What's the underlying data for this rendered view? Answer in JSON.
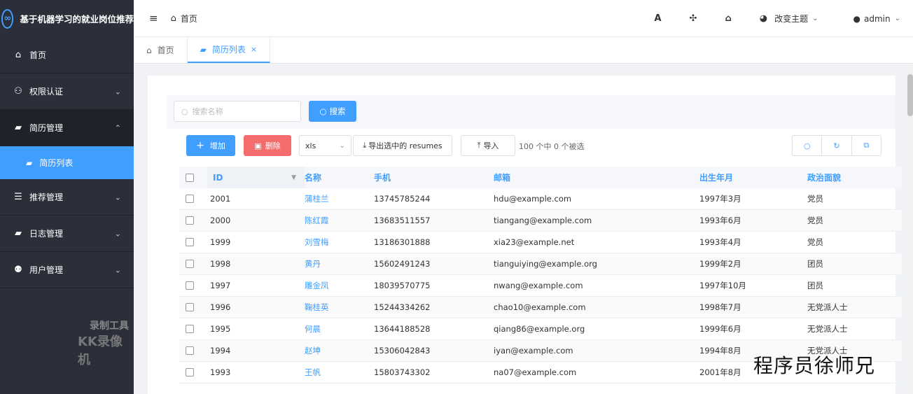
{
  "brand": {
    "logo": "∞",
    "title": "基于机器学习的就业岗位推荐"
  },
  "sidebar": {
    "items": [
      {
        "label": "首页",
        "icon": "home-icon",
        "glyph": "⌂"
      },
      {
        "label": "权限认证",
        "icon": "user-cog-icon",
        "glyph": "⚇"
      },
      {
        "label": "简历管理",
        "icon": "car-icon",
        "glyph": "▰"
      },
      {
        "label": "推荐管理",
        "icon": "list-icon",
        "glyph": "☰"
      },
      {
        "label": "日志管理",
        "icon": "car-icon",
        "glyph": "▰"
      },
      {
        "label": "用户管理",
        "icon": "users-icon",
        "glyph": "⚉"
      }
    ],
    "sub_item": {
      "label": "简历列表",
      "glyph": "▰"
    }
  },
  "watermark": {
    "line1": "录制工具",
    "line2": "KK录像机"
  },
  "navbar": {
    "hamburger": "≡",
    "breadcrumb": "首页",
    "icons": {
      "font": "A",
      "fullscreen": "✣",
      "home": "⌂"
    },
    "theme_label": "改变主题",
    "user": "admin"
  },
  "tabs": [
    {
      "label": "首页"
    },
    {
      "label": "简历列表",
      "close": "×"
    }
  ],
  "search": {
    "placeholder": "搜索名称",
    "button": "搜索"
  },
  "toolbar": {
    "add": "增加",
    "delete": "删除",
    "format": "xls",
    "export": "导出选中的 resumes",
    "import": "导入",
    "selection_info": "100 个中 0 个被选"
  },
  "table": {
    "headers": [
      "ID",
      "名称",
      "手机",
      "邮箱",
      "出生年月",
      "政治面貌"
    ],
    "rows": [
      [
        "2001",
        "蒲桂兰",
        "13745785244",
        "hdu@example.com",
        "1997年3月",
        "党员"
      ],
      [
        "2000",
        "陈红霞",
        "13683511557",
        "tiangang@example.com",
        "1993年6月",
        "党员"
      ],
      [
        "1999",
        "刘雪梅",
        "13186301888",
        "xia23@example.net",
        "1993年4月",
        "党员"
      ],
      [
        "1998",
        "黄丹",
        "15602491243",
        "tianguiying@example.org",
        "1999年2月",
        "团员"
      ],
      [
        "1997",
        "雕金凤",
        "18039570775",
        "nwang@example.com",
        "1997年10月",
        "团员"
      ],
      [
        "1996",
        "鞠桂英",
        "15244334262",
        "chao10@example.com",
        "1998年7月",
        "无党派人士"
      ],
      [
        "1995",
        "何晨",
        "13644188528",
        "qiang86@example.org",
        "1999年6月",
        "无党派人士"
      ],
      [
        "1994",
        "赵坤",
        "15306042843",
        "iyan@example.com",
        "1994年8月",
        "无党派人士"
      ],
      [
        "1993",
        "王帆",
        "15803743302",
        "na07@example.com",
        "2001年8月",
        ""
      ]
    ]
  },
  "overlay": "程序员徐师兄"
}
